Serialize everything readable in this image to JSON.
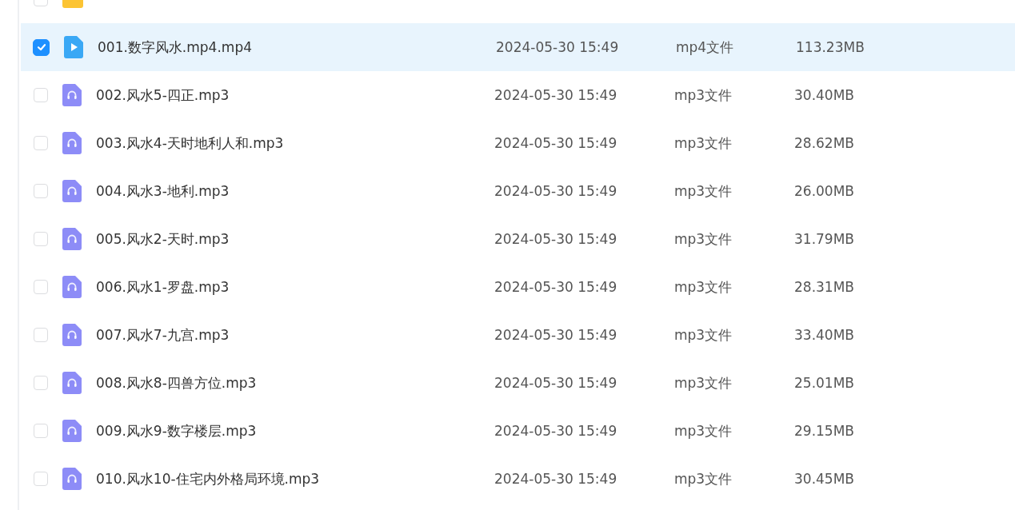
{
  "files": [
    {
      "kind": "folder",
      "selected": false
    },
    {
      "kind": "video",
      "name": "001.数字风水.mp4.mp4",
      "modified": "2024-05-30 15:49",
      "type": "mp4文件",
      "size": "113.23MB",
      "selected": true
    },
    {
      "kind": "audio",
      "name": "002.风水5-四正.mp3",
      "modified": "2024-05-30 15:49",
      "type": "mp3文件",
      "size": "30.40MB",
      "selected": false
    },
    {
      "kind": "audio",
      "name": "003.风水4-天时地利人和.mp3",
      "modified": "2024-05-30 15:49",
      "type": "mp3文件",
      "size": "28.62MB",
      "selected": false
    },
    {
      "kind": "audio",
      "name": "004.风水3-地利.mp3",
      "modified": "2024-05-30 15:49",
      "type": "mp3文件",
      "size": "26.00MB",
      "selected": false
    },
    {
      "kind": "audio",
      "name": "005.风水2-天时.mp3",
      "modified": "2024-05-30 15:49",
      "type": "mp3文件",
      "size": "31.79MB",
      "selected": false
    },
    {
      "kind": "audio",
      "name": "006.风水1-罗盘.mp3",
      "modified": "2024-05-30 15:49",
      "type": "mp3文件",
      "size": "28.31MB",
      "selected": false
    },
    {
      "kind": "audio",
      "name": "007.风水7-九宫.mp3",
      "modified": "2024-05-30 15:49",
      "type": "mp3文件",
      "size": "33.40MB",
      "selected": false
    },
    {
      "kind": "audio",
      "name": "008.风水8-四兽方位.mp3",
      "modified": "2024-05-30 15:49",
      "type": "mp3文件",
      "size": "25.01MB",
      "selected": false
    },
    {
      "kind": "audio",
      "name": "009.风水9-数字楼层.mp3",
      "modified": "2024-05-30 15:49",
      "type": "mp3文件",
      "size": "29.15MB",
      "selected": false
    },
    {
      "kind": "audio",
      "name": "010.风水10-住宅内外格局环境.mp3",
      "modified": "2024-05-30 15:49",
      "type": "mp3文件",
      "size": "30.45MB",
      "selected": false
    }
  ]
}
